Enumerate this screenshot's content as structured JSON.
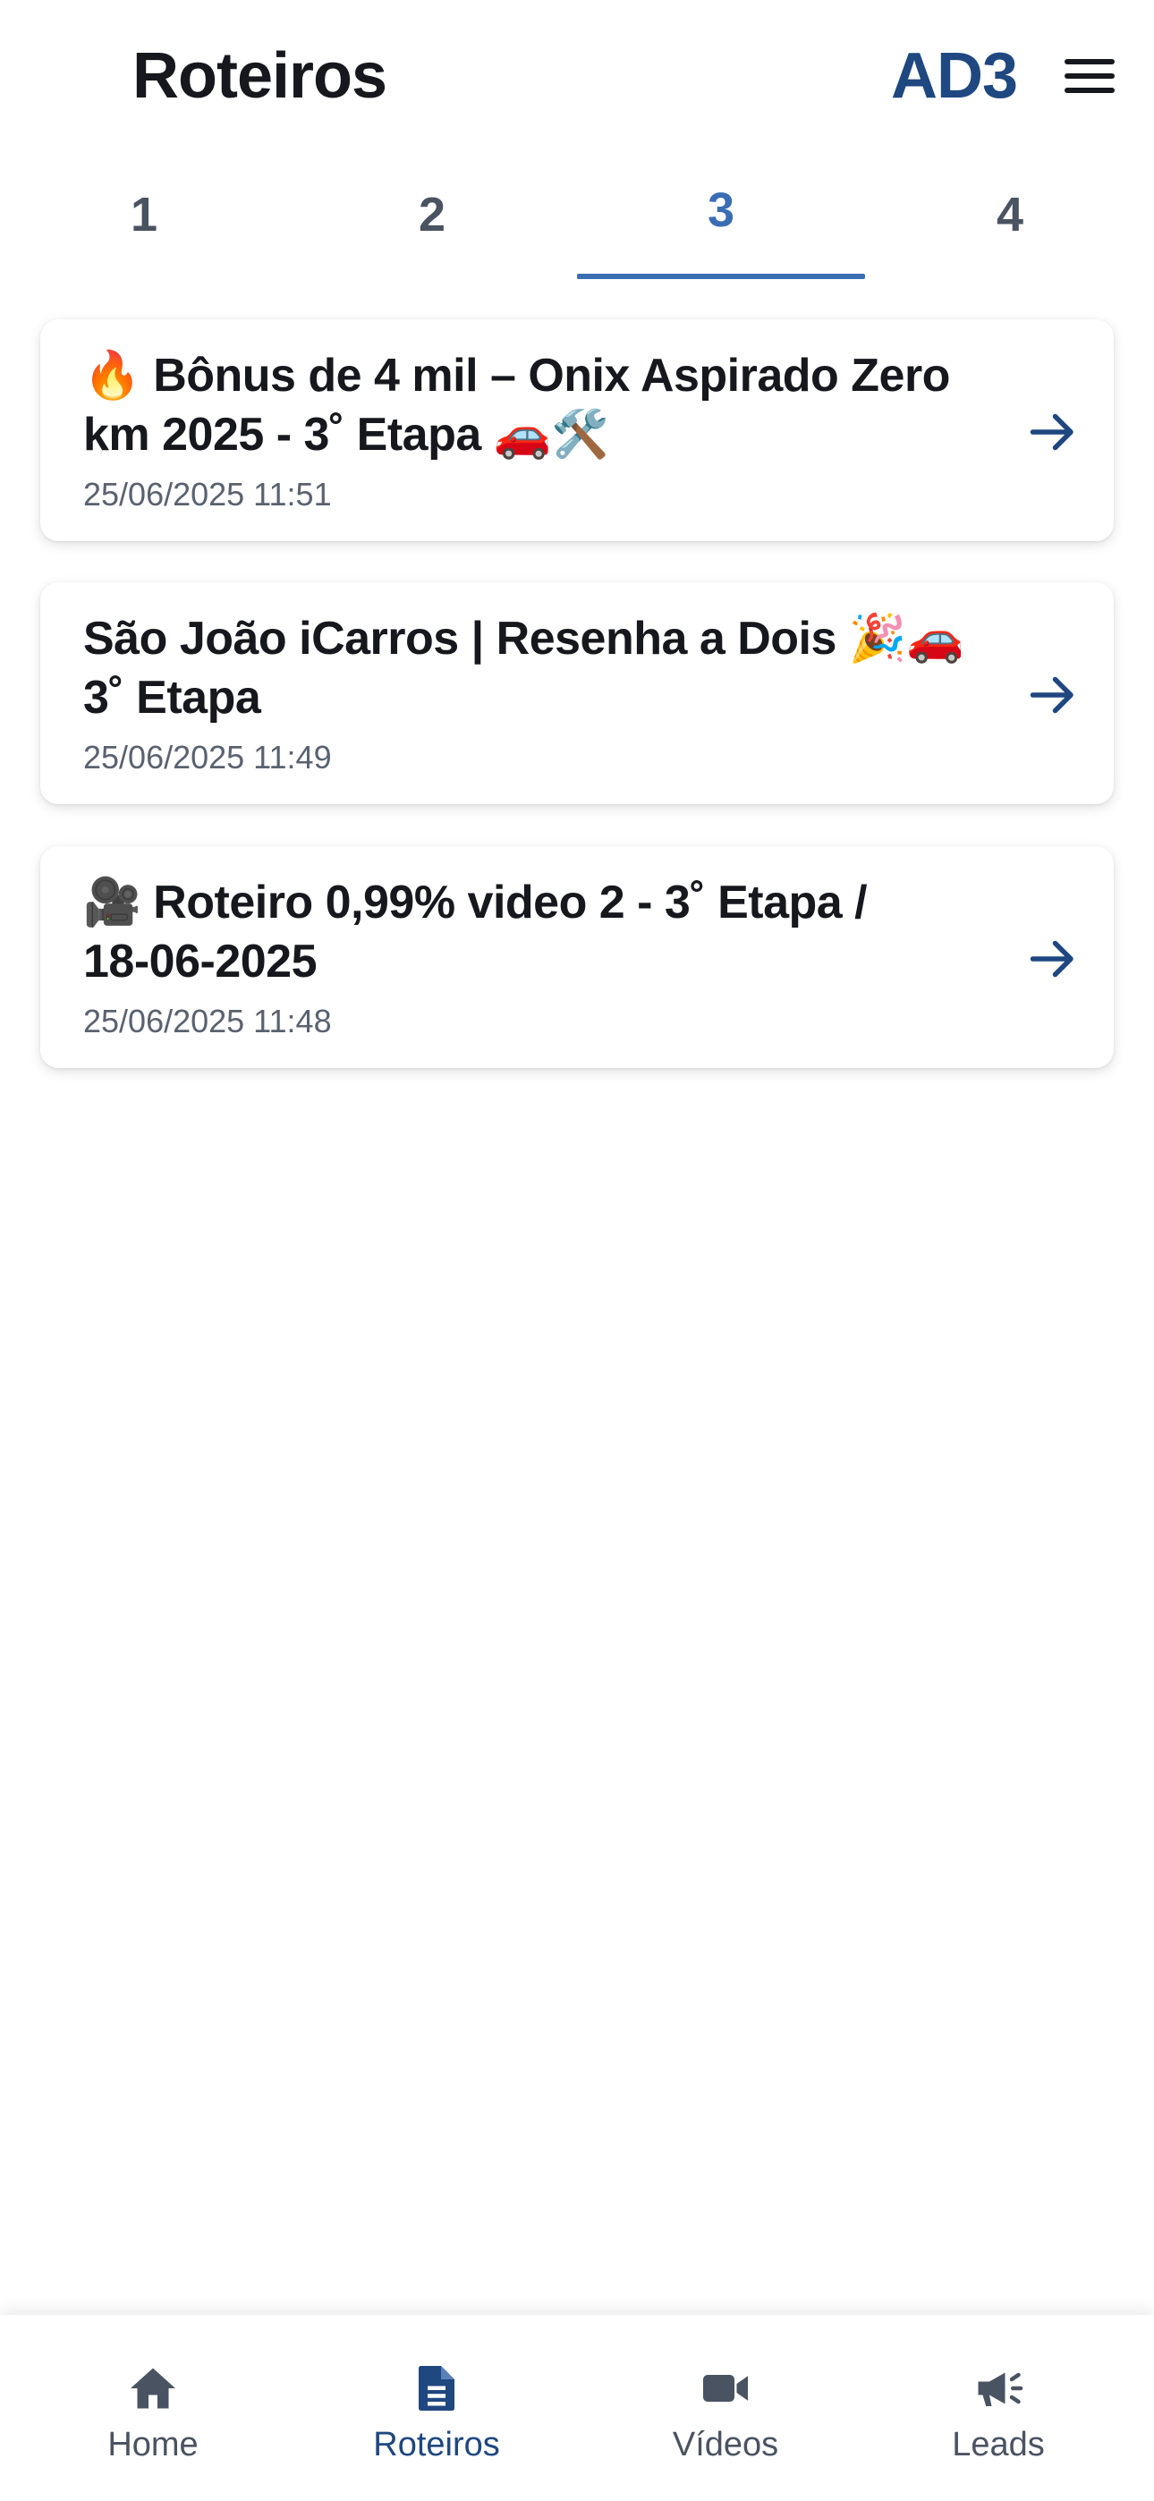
{
  "header": {
    "title": "Roteiros",
    "brand": "AD3",
    "menu_icon": "hamburger-menu-icon"
  },
  "tabs": [
    {
      "label": "1",
      "active": false
    },
    {
      "label": "2",
      "active": false
    },
    {
      "label": "3",
      "active": true
    },
    {
      "label": "4",
      "active": false
    }
  ],
  "cards": [
    {
      "title_line1": "🔥 Bônus de 4 mil – Onix Aspirado Zero",
      "title_line2": "km 2025 - 3˚ Etapa 🚗🛠️",
      "date": "25/06/2025 11:51",
      "icon": "arrow-right-icon"
    },
    {
      "title_line1": "São João iCarros | Resenha a Dois 🎉🚗",
      "title_line2": "3˚ Etapa",
      "date": "25/06/2025 11:49",
      "icon": "arrow-right-icon"
    },
    {
      "title_line1": "🎥 Roteiro 0,99% video 2 - 3˚ Etapa /",
      "title_line2": "18-06-2025",
      "date": "25/06/2025 11:48",
      "icon": "arrow-right-icon"
    }
  ],
  "bottom_nav": [
    {
      "label": "Home",
      "icon": "home-icon",
      "active": false
    },
    {
      "label": "Roteiros",
      "icon": "document-icon",
      "active": true
    },
    {
      "label": "Vídeos",
      "icon": "video-camera-icon",
      "active": false
    },
    {
      "label": "Leads",
      "icon": "megaphone-icon",
      "active": false
    }
  ],
  "colors": {
    "accent": "#3a6db3",
    "brand": "#1f4780",
    "text": "#16181d",
    "muted": "#5a6270"
  }
}
